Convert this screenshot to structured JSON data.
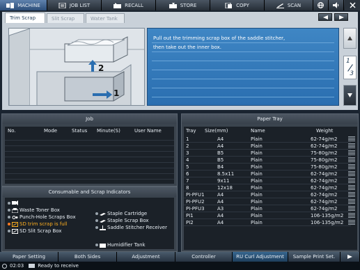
{
  "topnav": {
    "items": [
      {
        "label": "MACHINE",
        "icon": "machine-icon",
        "active": true
      },
      {
        "label": "JOB LIST",
        "icon": "job-list-icon",
        "active": false
      },
      {
        "label": "RECALL",
        "icon": "recall-icon",
        "active": false
      },
      {
        "label": "STORE",
        "icon": "store-icon",
        "active": false
      },
      {
        "label": "COPY",
        "icon": "copy-icon",
        "active": false
      },
      {
        "label": "SCAN",
        "icon": "scan-icon",
        "active": false
      }
    ],
    "extra_icons": [
      "globe-icon",
      "speaker-icon",
      "close-icon"
    ]
  },
  "tabs": [
    {
      "label": "Trim Scrap",
      "active": true
    },
    {
      "label": "Slit Scrap",
      "active": false
    },
    {
      "label": "Water Tank",
      "active": false
    }
  ],
  "guidance": {
    "lines": [
      "Pull out the trimming scrap box of the saddle stitcher,",
      "then take out the inner box.",
      "",
      "",
      "",
      "",
      ""
    ],
    "step_labels": [
      "2",
      "1"
    ],
    "page_current": "1",
    "page_total": "3"
  },
  "job": {
    "title": "Job",
    "columns": [
      "No.",
      "Mode",
      "Status",
      "Minute(S)",
      "User Name"
    ]
  },
  "consumables": {
    "title": "Consumable and Scrap Indicators",
    "left": [
      {
        "label": "",
        "icon": "toner-icon",
        "warn": false
      },
      {
        "label": "Waste Toner Box",
        "icon": "waste-toner-box-icon",
        "warn": false
      },
      {
        "label": "Punch-Hole Scraps Box",
        "icon": "punch-hole-icon",
        "warn": false
      },
      {
        "label": "SD trim scrap is full",
        "icon": "trim-scrap-icon",
        "warn": true
      },
      {
        "label": "SD Slit Scrap Box",
        "icon": "slit-scrap-icon",
        "warn": false
      }
    ],
    "right": [
      {
        "label": "Staple Cartridge",
        "icon": "staple-cartridge-icon",
        "warn": false
      },
      {
        "label": "Staple Scrap Box",
        "icon": "staple-scrap-icon",
        "warn": false
      },
      {
        "label": "Saddle Stitcher Receiver",
        "icon": "saddle-stitcher-icon",
        "warn": false
      }
    ],
    "bottom": {
      "label": "Humidifier Tank",
      "icon": "humidifier-tank-icon"
    }
  },
  "tray": {
    "title": "Paper Tray",
    "columns": [
      "Tray",
      "Size(mm)",
      "Name",
      "Weight"
    ],
    "rows": [
      [
        "1",
        "A4",
        "Plain",
        "62-74g/m2"
      ],
      [
        "2",
        "A4",
        "Plain",
        "62-74g/m2"
      ],
      [
        "3",
        "B5",
        "Plain",
        "75-80g/m2"
      ],
      [
        "4",
        "B5",
        "Plain",
        "75-80g/m2"
      ],
      [
        "5",
        "B4",
        "Plain",
        "75-80g/m2"
      ],
      [
        "6",
        "8.5x11",
        "Plain",
        "62-74g/m2"
      ],
      [
        "7",
        "9x11",
        "Plain",
        "62-74g/m2"
      ],
      [
        "8",
        "12x18",
        "Plain",
        "62-74g/m2"
      ],
      [
        "PI-PFU1",
        "A4",
        "Plain",
        "62-74g/m2"
      ],
      [
        "PI-PFU2",
        "A4",
        "Plain",
        "62-74g/m2"
      ],
      [
        "PI-PFU3",
        "A3",
        "Plain",
        "62-74g/m2"
      ],
      [
        "PI1",
        "A4",
        "Plain",
        "106-135g/m2"
      ],
      [
        "PI2",
        "A4",
        "Plain",
        "106-135g/m2"
      ]
    ]
  },
  "funcbar": [
    "Paper Setting",
    "Both Sides",
    "Adjustment",
    "Controller",
    "RU Curl Adjustment",
    "Sample Print Set."
  ],
  "status": {
    "time": "02:03",
    "message": "Ready to receive"
  }
}
